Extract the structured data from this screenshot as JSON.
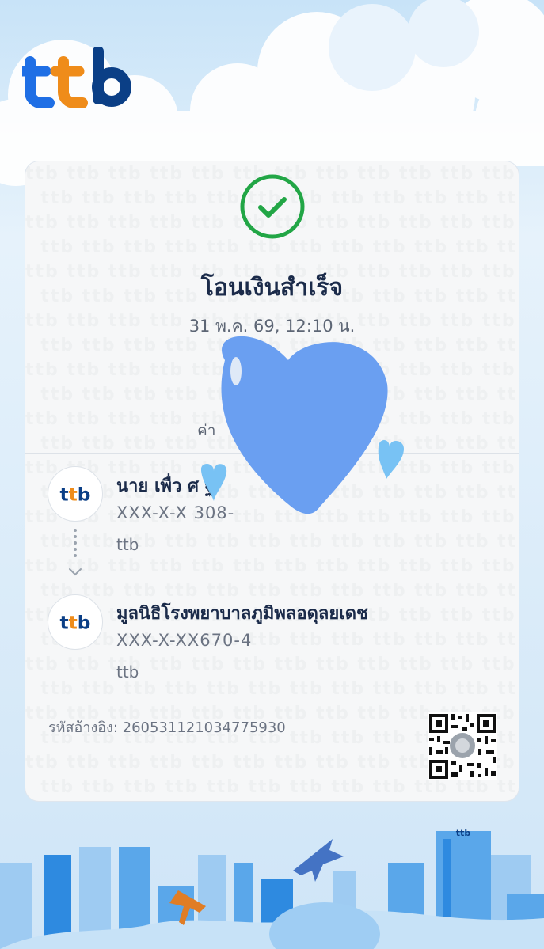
{
  "brand": {
    "name": "ttb",
    "colors": {
      "navy": "#0b3f86",
      "blue": "#1f6fe5",
      "orange": "#ef8c1a"
    }
  },
  "transfer": {
    "status": "โอนเงินสำเร็จ",
    "datetime": "31 พ.ค. 69, 12:10 น.",
    "fee_label": "ค่า"
  },
  "sender": {
    "name": "นาย เพื่ว   ศ                ฐิ",
    "account": "XXX-X-X   308-",
    "bank": "ttb",
    "logo_text": "ttb"
  },
  "receiver": {
    "name": "มูลนิธิโรงพยาบาลภูมิพลอดุลยเดช",
    "account": "XXX-X-XX670-4",
    "bank": "ttb",
    "logo_text": "ttb"
  },
  "reference": {
    "label": "รหัสอ้างอิง: 2605311210347759​30",
    "text": "รหัสอ้างอิง: 260531121034775930"
  },
  "icons": {
    "status": "check-circle-icon",
    "qr": "qr-code-icon",
    "flow": "chevron-down-icon"
  },
  "city_sign": "ttb"
}
